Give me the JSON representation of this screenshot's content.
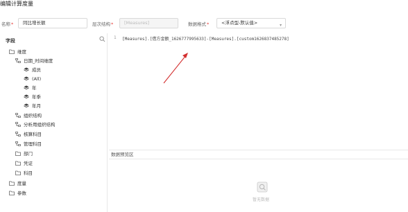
{
  "header": {
    "title": "编辑计算度量"
  },
  "form": {
    "name_label": "名称",
    "name_value": "同比增长额",
    "hierarchy_label": "层次结构",
    "hierarchy_placeholder": "[Measures]",
    "format_label": "数据格式",
    "format_value": "<浮点型-默认值>"
  },
  "sidebar": {
    "heading": "字段",
    "items": [
      {
        "label": "维度"
      },
      {
        "label": "日期_时间维度"
      },
      {
        "label": "成员"
      },
      {
        "label": "(All)"
      },
      {
        "label": "年"
      },
      {
        "label": "年季"
      },
      {
        "label": "年月"
      },
      {
        "label": "组织结构"
      },
      {
        "label": "分析用组织结构"
      },
      {
        "label": "核算科目"
      },
      {
        "label": "管理科目"
      },
      {
        "label": "部门"
      },
      {
        "label": "凭证"
      },
      {
        "label": "科目"
      },
      {
        "label": "度量"
      },
      {
        "label": "参数"
      }
    ]
  },
  "editor": {
    "line_number": "1",
    "code": "[Measures].[借方金额_1626777995633]-[Measures].[custom1626837485278]"
  },
  "preview": {
    "header": "数据预览区",
    "empty_text": "暂无数据"
  },
  "colors": {
    "annotation_arrow": "#d32f2f",
    "required": "#e53935"
  }
}
